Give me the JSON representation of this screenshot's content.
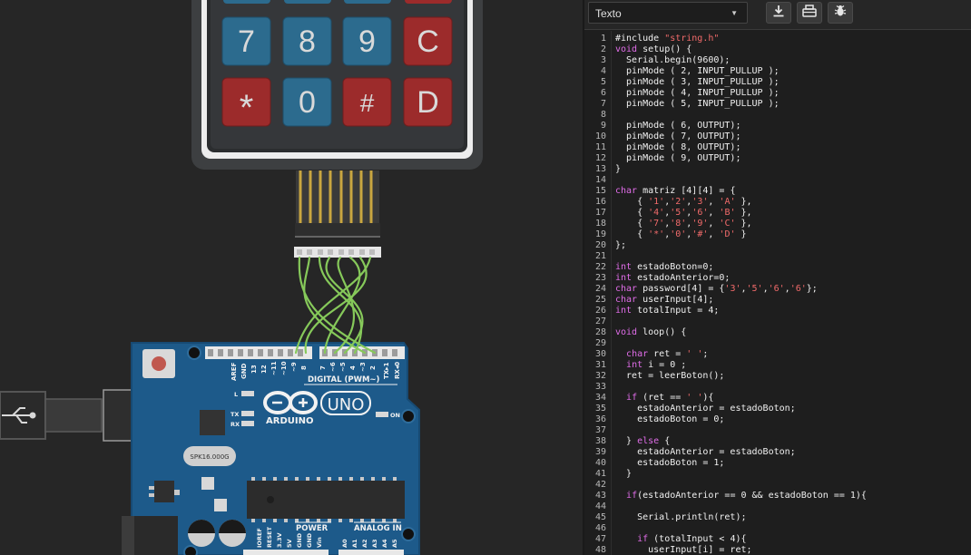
{
  "toolbar": {
    "mode_label": "Texto",
    "icons": [
      "download-icon",
      "library-icon",
      "debug-bug-icon"
    ]
  },
  "keypad": {
    "keys_visible": [
      "7",
      "8",
      "9",
      "C",
      "*",
      "0",
      "#",
      "D"
    ]
  },
  "arduino": {
    "brand": "ARDUINO",
    "model": "UNO",
    "digital_header": "DIGITAL (PWM~)",
    "power_header": "POWER",
    "analog_header": "ANALOG IN",
    "oscillator": "SPK16.000G",
    "led_labels": [
      "L",
      "TX",
      "RX"
    ],
    "on_label": "ON",
    "digital_pins": [
      "AREF",
      "GND",
      "13",
      "12",
      "~11",
      "~10",
      "~9",
      "8",
      "7",
      "~6",
      "~5",
      "4",
      "~3",
      "2",
      "TX▸1",
      "RX◂0"
    ],
    "power_pins": [
      "IOREF",
      "RESET",
      "3.3V",
      "5V",
      "GND",
      "GND",
      "Vin"
    ],
    "analog_pins": [
      "A0",
      "A1",
      "A2",
      "A3",
      "A4",
      "A5"
    ]
  },
  "code": {
    "lines": [
      "#include \"string.h\"",
      "void setup() {",
      "  Serial.begin(9600);",
      "  pinMode ( 2, INPUT_PULLUP );",
      "  pinMode ( 3, INPUT_PULLUP );",
      "  pinMode ( 4, INPUT_PULLUP );",
      "  pinMode ( 5, INPUT_PULLUP );",
      "",
      "  pinMode ( 6, OUTPUT);",
      "  pinMode ( 7, OUTPUT);",
      "  pinMode ( 8, OUTPUT);",
      "  pinMode ( 9, OUTPUT);",
      "}",
      "",
      "char matriz [4][4] = {",
      "    { '1','2','3', 'A' },",
      "    { '4','5','6', 'B' },",
      "    { '7','8','9', 'C' },",
      "    { '*','0','#', 'D' }",
      "};",
      "",
      "int estadoBoton=0;",
      "int estadoAnterior=0;",
      "char password[4] = {'3','5','6','6'};",
      "char userInput[4];",
      "int totalInput = 4;",
      "",
      "void loop() {",
      "",
      "  char ret = ' ';",
      "  int i = 0 ;",
      "  ret = leerBoton();",
      "",
      "  if (ret == ' '){",
      "    estadoAnterior = estadoBoton;",
      "    estadoBoton = 0;",
      "",
      "  } else {",
      "    estadoAnterior = estadoBoton;",
      "    estadoBoton = 1;",
      "  }",
      "",
      "  if(estadoAnterior == 0 && estadoBoton == 1){",
      "",
      "    Serial.println(ret);",
      "",
      "    if (totalInput < 4){",
      "      userInput[i] = ret;"
    ]
  },
  "colors": {
    "canvas_bg": "#262626",
    "editor_bg": "#1e1e1e",
    "keyword": "#e16de9",
    "string": "#f06a6a",
    "board_blue": "#1d5a8a",
    "wire_green": "#86c95a",
    "key_blue": "#2c6b8e",
    "key_red": "#9c2b2b"
  }
}
